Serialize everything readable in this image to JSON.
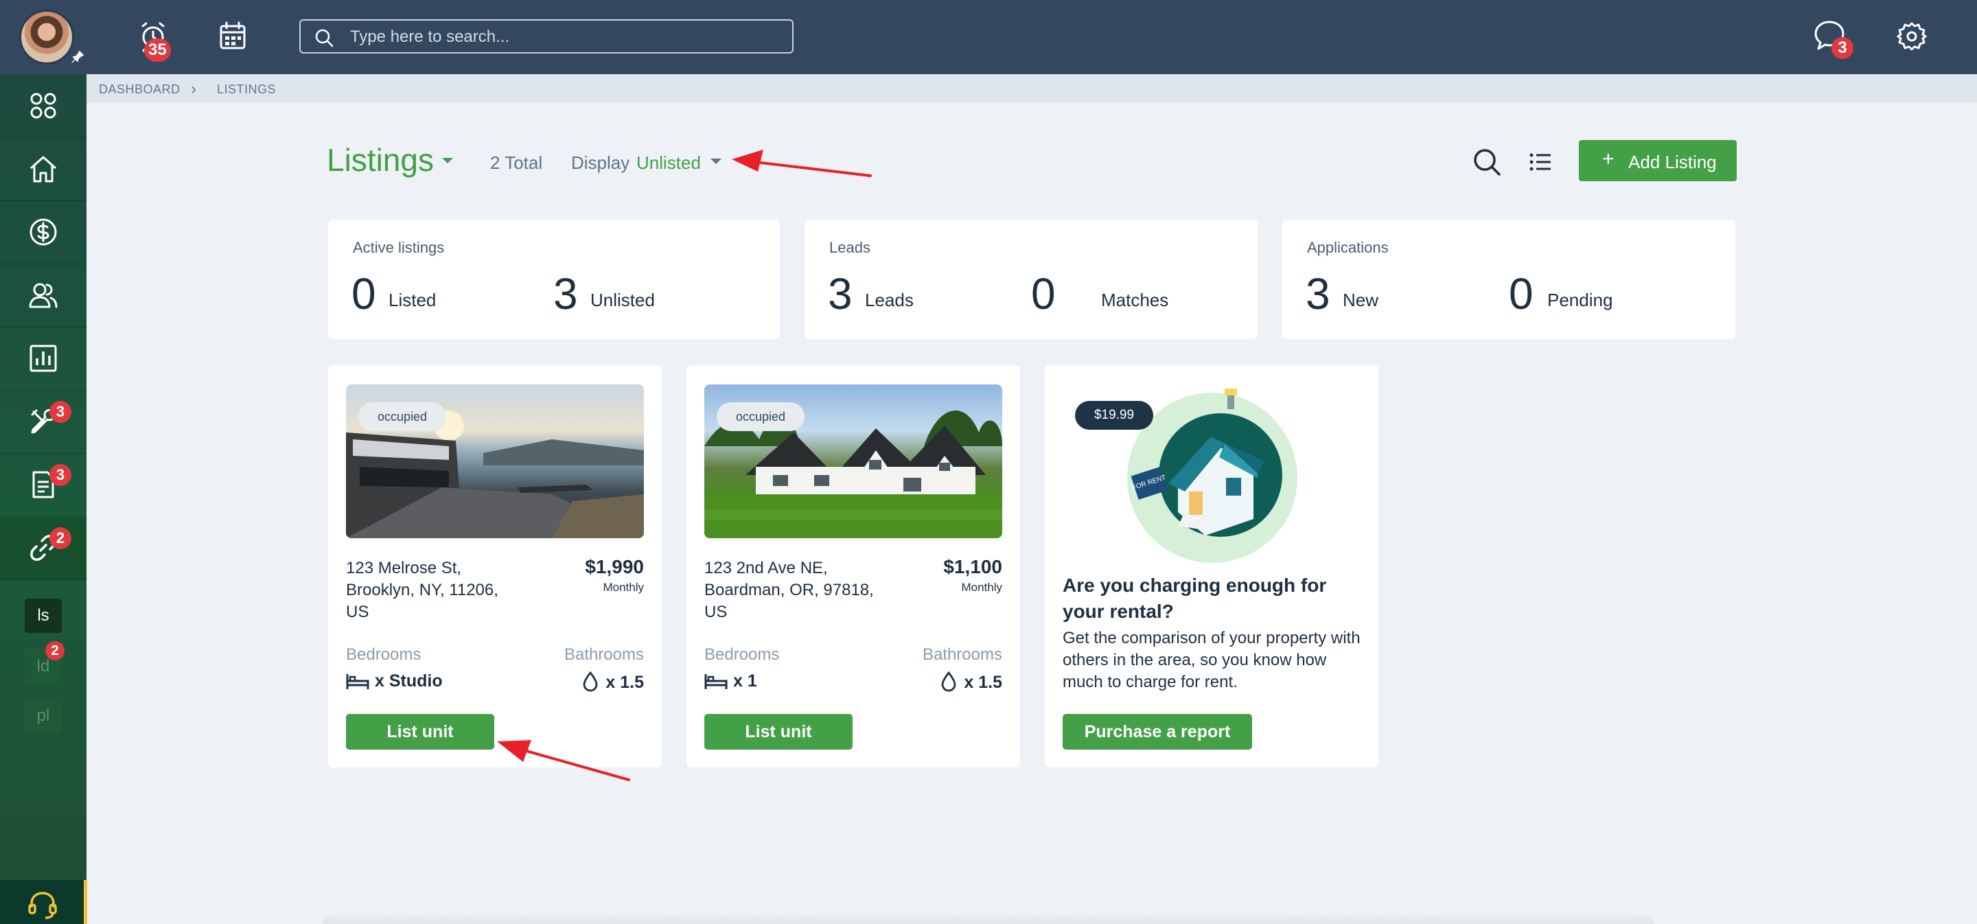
{
  "topbar": {
    "alerts_badge": "35",
    "search_placeholder": "Type here to search...",
    "messages_badge": "3"
  },
  "sidebar": {
    "items": [
      {
        "icon": "apps-grid-icon",
        "badge": ""
      },
      {
        "icon": "home-icon",
        "badge": ""
      },
      {
        "icon": "dollar-icon",
        "badge": ""
      },
      {
        "icon": "people-icon",
        "badge": ""
      },
      {
        "icon": "reports-chart-icon",
        "badge": ""
      },
      {
        "icon": "tools-icon",
        "badge": "3"
      },
      {
        "icon": "document-icon",
        "badge": "3"
      },
      {
        "icon": "link-icon",
        "badge": "2"
      }
    ],
    "subitems": [
      {
        "label": "ls",
        "badge": ""
      },
      {
        "label": "ld",
        "badge": "2"
      },
      {
        "label": "pl",
        "badge": ""
      }
    ]
  },
  "breadcrumb": {
    "dashboard": "DASHBOARD",
    "separator": "›",
    "current": "LISTINGS"
  },
  "header": {
    "title": "Listings",
    "total": "2 Total",
    "display_label": "Display",
    "display_value": "Unlisted",
    "add_button": "Add Listing",
    "add_plus": "+"
  },
  "stats": [
    {
      "title": "Active listings",
      "items": [
        {
          "num": "0",
          "label": "Listed"
        },
        {
          "num": "3",
          "label": "Unlisted"
        }
      ]
    },
    {
      "title": "Leads",
      "items": [
        {
          "num": "3",
          "label": "Leads"
        },
        {
          "num": "0",
          "label": "Matches"
        }
      ]
    },
    {
      "title": "Applications",
      "items": [
        {
          "num": "3",
          "label": "New"
        },
        {
          "num": "0",
          "label": "Pending"
        }
      ]
    }
  ],
  "listings": [
    {
      "status": "occupied",
      "address": "123 Melrose St, Brooklyn, NY, 11206, US",
      "price": "$1,990",
      "period": "Monthly",
      "bed_label": "Bedrooms",
      "bath_label": "Bathrooms",
      "beds": "x Studio",
      "baths": "x 1.5",
      "button": "List unit"
    },
    {
      "status": "occupied",
      "address": "123 2nd Ave NE, Boardman, OR, 97818, US",
      "price": "$1,100",
      "period": "Monthly",
      "bed_label": "Bedrooms",
      "bath_label": "Bathrooms",
      "beds": "x 1",
      "baths": "x 1.5",
      "button": "List unit"
    }
  ],
  "promo": {
    "price_tag": "$19.99",
    "title": "Are you charging enough for your rental?",
    "text": "Get the comparison of your property with others in the area, so you know how much to charge for rent.",
    "button": "Purchase a report",
    "sign_text": "FOR RENT"
  },
  "colors": {
    "topbar": "#33475e",
    "accent_green": "#43a047",
    "badge_red": "#e03a3e",
    "annotation_arrow": "#e8202a"
  }
}
